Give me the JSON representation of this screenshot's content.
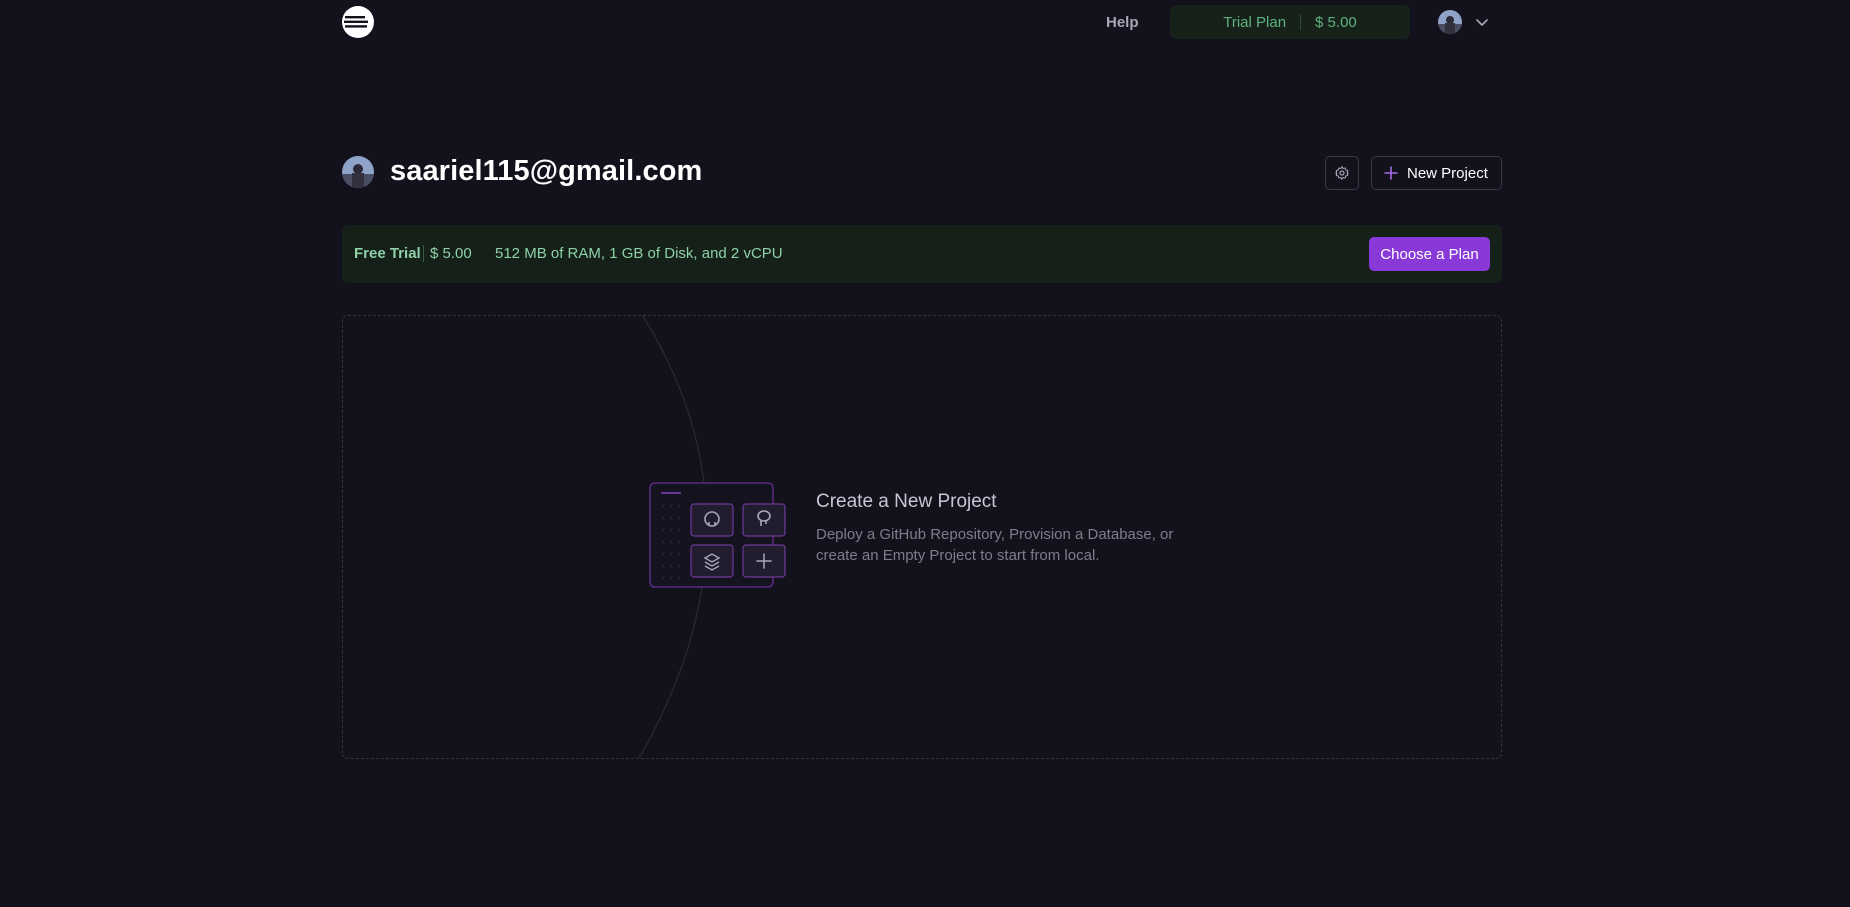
{
  "nav": {
    "help_label": "Help",
    "plan_label": "Trial Plan",
    "plan_amount": "$ 5.00"
  },
  "header": {
    "email": "saariel115@gmail.com",
    "new_project_label": "New Project"
  },
  "trial_bar": {
    "label": "Free Trial",
    "amount": "$ 5.00",
    "specs": "512 MB of RAM, 1 GB of Disk, and 2 vCPU",
    "choose_plan_label": "Choose a Plan"
  },
  "empty_state": {
    "title": "Create a New Project",
    "description": "Deploy a GitHub Repository, Provision a Database, or create an Empty Project to start from local."
  },
  "icons": [
    "railway-logo-icon",
    "user-avatar",
    "chevron-down-icon",
    "gear-icon",
    "plus-icon",
    "github-icon",
    "postgres-icon",
    "layers-icon",
    "plus-icon"
  ],
  "colors": {
    "background": "#13111c",
    "accent_purple": "#8839d8",
    "trial_green": "#5fb17f"
  }
}
